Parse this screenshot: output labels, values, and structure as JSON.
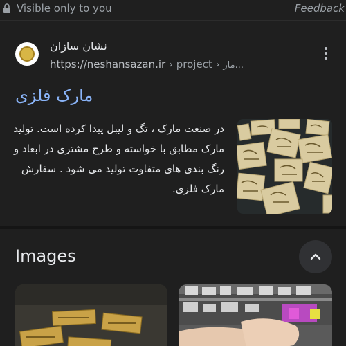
{
  "topbar": {
    "visibility_label": "Visible only to you",
    "feedback_label": "Feedback"
  },
  "result": {
    "site_name": "نشان سازان",
    "url_base": "https://neshansazan.ir",
    "breadcrumb_1": " › project › ",
    "breadcrumb_2": "مار...",
    "title": "مارک فلزی",
    "snippet": "در صنعت مارک ، تگ و لیبل پیدا کرده است. تولید مارک مطابق با خواسته و طرح مشتری در ابعاد و رنگ بندی های متفاوت تولید می شود . سفارش مارک فلزی."
  },
  "images_section": {
    "heading": "Images"
  },
  "colors": {
    "background": "#1f1f1f",
    "link_title": "#8ab4f8",
    "muted_text": "#9aa0a6"
  }
}
